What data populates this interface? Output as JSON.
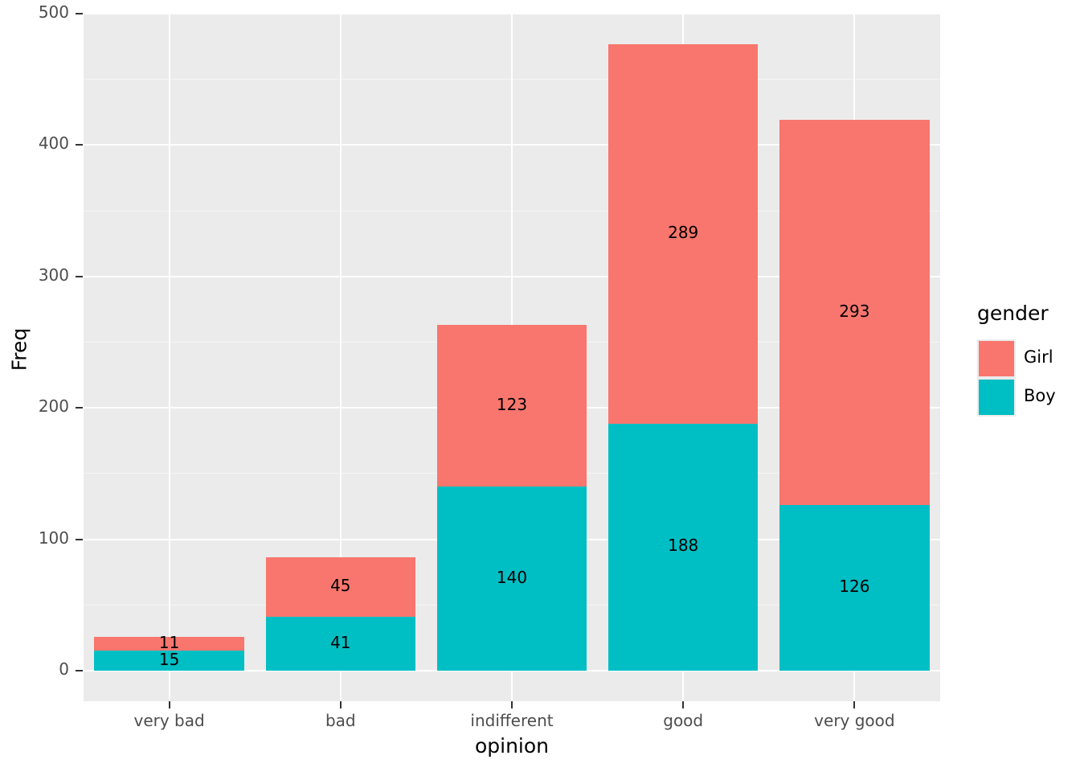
{
  "chart_data": {
    "type": "bar",
    "stacked": true,
    "title": "",
    "xlabel": "opinion",
    "ylabel": "Freq",
    "categories": [
      "very bad",
      "bad",
      "indifferent",
      "good",
      "very good"
    ],
    "series": [
      {
        "name": "Boy",
        "color": "#00BFC4",
        "values": [
          15,
          41,
          140,
          188,
          126
        ]
      },
      {
        "name": "Girl",
        "color": "#F8766D",
        "values": [
          11,
          45,
          123,
          289,
          293
        ]
      }
    ],
    "stack_order_bottom_to_top": [
      "Boy",
      "Girl"
    ],
    "totals": [
      26,
      86,
      263,
      477,
      419
    ],
    "ylim": [
      0,
      500
    ],
    "y_ticks": [
      0,
      100,
      200,
      300,
      400,
      500
    ],
    "y_tick_labels": [
      "0",
      "100",
      "200",
      "300",
      "400",
      "500"
    ],
    "y_minor_ticks": [
      50,
      150,
      250,
      350,
      450
    ],
    "grid": true,
    "legend": {
      "title": "gender",
      "position": "right",
      "entries": [
        {
          "label": "Girl",
          "color": "#F8766D"
        },
        {
          "label": "Boy",
          "color": "#00BFC4"
        }
      ]
    },
    "panel_background": "#EBEBEB",
    "gridline_color": "#FFFFFF",
    "bar_value_labels": [
      {
        "category": "very bad",
        "series": "Girl",
        "value": 11
      },
      {
        "category": "very bad",
        "series": "Boy",
        "value": 15
      },
      {
        "category": "bad",
        "series": "Girl",
        "value": 45
      },
      {
        "category": "bad",
        "series": "Boy",
        "value": 41
      },
      {
        "category": "indifferent",
        "series": "Girl",
        "value": 123
      },
      {
        "category": "indifferent",
        "series": "Boy",
        "value": 140
      },
      {
        "category": "good",
        "series": "Girl",
        "value": 289
      },
      {
        "category": "good",
        "series": "Boy",
        "value": 188
      },
      {
        "category": "very good",
        "series": "Girl",
        "value": 293
      },
      {
        "category": "very good",
        "series": "Boy",
        "value": 126
      }
    ]
  }
}
